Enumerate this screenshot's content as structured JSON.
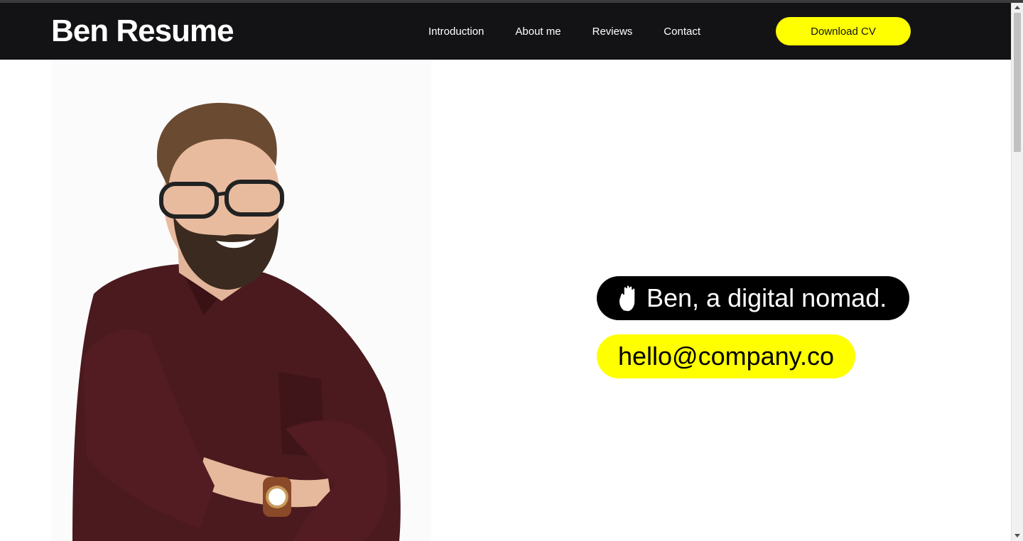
{
  "header": {
    "brand": "Ben Resume",
    "nav": [
      {
        "label": "Introduction"
      },
      {
        "label": "About me"
      },
      {
        "label": "Reviews"
      },
      {
        "label": "Contact"
      }
    ],
    "cta_label": "Download CV"
  },
  "hero": {
    "greeting": "Ben, a digital nomad.",
    "greeting_icon": "waving-hand-icon",
    "email": "hello@company.co",
    "photo_icon": "portrait-photo"
  },
  "colors": {
    "nav_background": "#131316",
    "accent_yellow": "#ffff00",
    "pill_black": "#000000",
    "shirt": "#4a1a1e"
  }
}
